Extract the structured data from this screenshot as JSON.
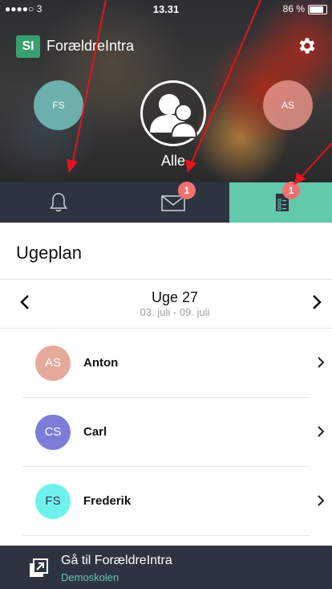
{
  "status_bar": {
    "carrier": "●●●●○ 3",
    "time": "13.31",
    "battery": "86 %"
  },
  "app": {
    "logo": "SI",
    "title": "ForældreIntra"
  },
  "profiles": {
    "left": "FS",
    "center_label": "Alle",
    "right": "AS"
  },
  "tabs": {
    "messages_badge": "1",
    "plan_badge": "1"
  },
  "section": {
    "title": "Ugeplan"
  },
  "week": {
    "title": "Uge 27",
    "range": "03. juli - 09. juli"
  },
  "children": [
    {
      "initials": "AS",
      "name": "Anton",
      "color": "#e6aa9d"
    },
    {
      "initials": "CS",
      "name": "Carl",
      "color": "#7b7dd6"
    },
    {
      "initials": "FS",
      "name": "Frederik",
      "color": "#6ff2ee"
    }
  ],
  "footer": {
    "title": "Gå til ForældreIntra",
    "subtitle": "Demoskolen"
  },
  "colors": {
    "accent": "#62c9ad",
    "tabbar": "#2d3440",
    "badge": "#f27272",
    "annotation": "#e8121c"
  }
}
